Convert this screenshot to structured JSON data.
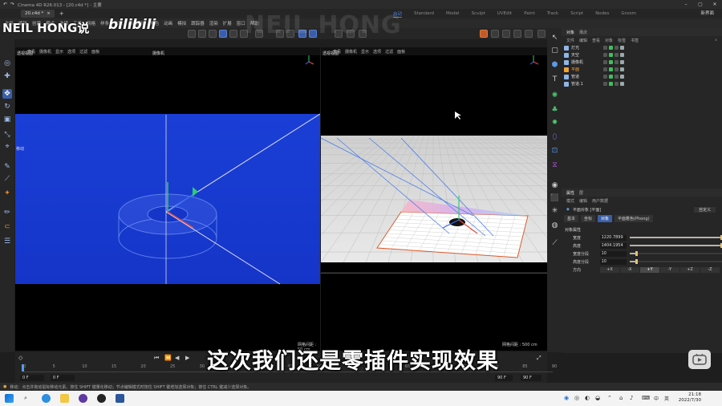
{
  "window": {
    "title": "Cinema 4D R26.013 - [20.c4d *] - 主要"
  },
  "tabs": {
    "doc": "20.c4d *",
    "add": "+"
  },
  "layouts": [
    "启动",
    "Standard",
    "Model",
    "Sculpt",
    "UVEdit",
    "Paint",
    "Track",
    "Script",
    "Nodes",
    "Groom"
  ],
  "layout_active": "启动",
  "new_layout": "新界面",
  "menu": [
    "文件",
    "编辑",
    "创建",
    "模式",
    "选择",
    "工具",
    "网格",
    "样条",
    "体积",
    "运动图形",
    "角色",
    "动画",
    "模拟",
    "跟踪器",
    "渲染",
    "扩展",
    "窗口",
    "帮助"
  ],
  "watermark": {
    "name": "NEIL HONG说",
    "bili": "bilibili",
    "ghost": "NEIL HONG"
  },
  "viewport_left": {
    "menu": [
      "查看",
      "摄像机",
      "显示",
      "选项",
      "过滤",
      "面板"
    ],
    "label": "透视视图",
    "camera": "摄像机",
    "move": "移动",
    "grid": "网格间距 : 50 cm"
  },
  "viewport_right": {
    "menu": [
      "查看",
      "摄像机",
      "显示",
      "选项",
      "过滤",
      "面板"
    ],
    "label": "透视视图",
    "grid": "网格间距 : 500 cm"
  },
  "objects_panel": {
    "tabs": [
      "对象",
      "场次"
    ],
    "menu": [
      "文件",
      "编辑",
      "查看",
      "对象",
      "标签",
      "书签"
    ],
    "rows": [
      {
        "name": "灯光",
        "color": "#8fb6e8"
      },
      {
        "name": "天空",
        "color": "#8fb6e8"
      },
      {
        "name": "摄像机",
        "color": "#8fb6e8"
      },
      {
        "name": "平面",
        "color": "#f0a23a"
      },
      {
        "name": "管道",
        "color": "#8fb6e8"
      },
      {
        "name": "管道.1",
        "color": "#8fb6e8"
      }
    ],
    "selected": "平面"
  },
  "attributes_panel": {
    "tabs": [
      "属性",
      "层"
    ],
    "menu": [
      "模式",
      "编辑",
      "用户数据"
    ],
    "object_title": "平面对象 [平面]",
    "custom": "自定义",
    "subtabs": [
      "基本",
      "坐标",
      "对象",
      "平面着色(Phong)"
    ],
    "subtab_active": "对象",
    "section": "对象属性",
    "fields": [
      {
        "label": "宽度",
        "value": "1220.7899",
        "fill": 1.0
      },
      {
        "label": "高度",
        "value": "1404.1954",
        "fill": 1.0
      },
      {
        "label": "宽度分段",
        "value": "10",
        "fill": 0.08
      },
      {
        "label": "高度分段",
        "value": "10",
        "fill": 0.08
      }
    ],
    "direction_label": "方向",
    "directions": [
      "+X",
      "-X",
      "+Y",
      "-Y",
      "+Z",
      "-Z"
    ],
    "direction_active": "+Y"
  },
  "timeline": {
    "ticks": [
      "0",
      "5",
      "10",
      "15",
      "20",
      "25",
      "30",
      "35",
      "40",
      "45",
      "50",
      "55",
      "60",
      "65",
      "70",
      "75",
      "80",
      "85",
      "90"
    ],
    "start": "0 F",
    "current": "0 F",
    "end": "90 F",
    "end2": "90 F"
  },
  "subtitle": "这次我们还是零插件实现效果",
  "status": "移动：点击并拖动鼠标移动元素。按住 SHIFT 键量化移动；节点编辑模式时按住 SHIFT 键增加选择对象；按住 CTRL 键减少选择对象。",
  "taskbar": {
    "time": "21:18",
    "date": "2022/7/30",
    "lang": "中",
    "lang2": "英"
  }
}
